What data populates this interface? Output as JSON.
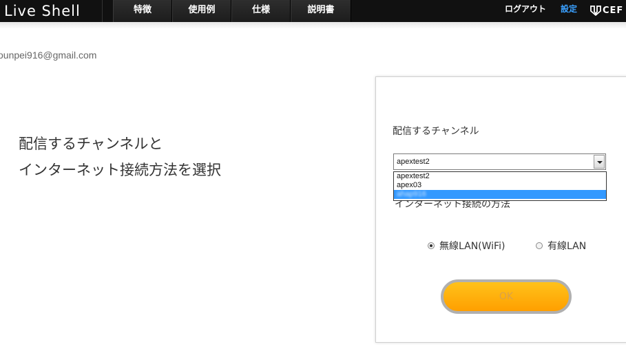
{
  "header": {
    "logo": "Live Shell",
    "nav": [
      "特徴",
      "使用例",
      "仕様",
      "説明書"
    ],
    "logout": "ログアウト",
    "settings": "設定",
    "brand": "CEF"
  },
  "account": {
    "email": "ounpei916@gmail.com"
  },
  "main": {
    "headline_line1": "配信するチャンネルと",
    "headline_line2": "インターネット接続方法を選択"
  },
  "form": {
    "channel_label": "配信するチャンネル",
    "channel_selected": "apextest2",
    "channel_options": [
      "apextest2",
      "apex03",
      "ahap916"
    ],
    "method_label": "インターネット接続の方法",
    "radio_wifi": "無線LAN(WiFi)",
    "radio_wired": "有線LAN",
    "radio_selected": "wifi",
    "ok": "OK"
  },
  "colors": {
    "accent": "#3aa0ff",
    "button": "#ffb000",
    "highlight": "#3399ff"
  }
}
